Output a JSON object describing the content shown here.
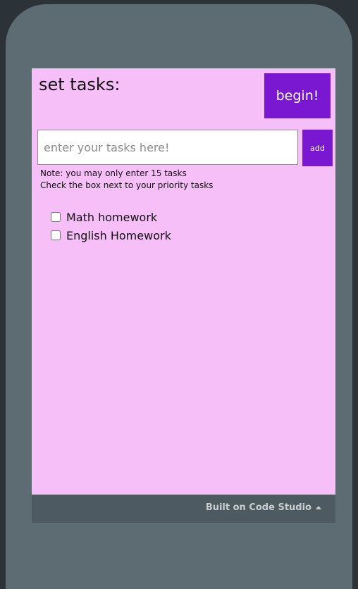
{
  "app": {
    "title": "set tasks:",
    "begin_label": "begin!"
  },
  "input": {
    "placeholder": "enter your tasks here!",
    "value": "",
    "add_label": "add"
  },
  "notes": {
    "line1": "Note: you may only enter 15 tasks",
    "line2": "Check the box next to your priority tasks"
  },
  "tasks": [
    {
      "label": "Math homework",
      "checked": false
    },
    {
      "label": "English Homework",
      "checked": false
    }
  ],
  "footer": {
    "label": "Built on Code Studio",
    "icon": "caret-up-icon"
  },
  "colors": {
    "screen_bg": "#f6bff7",
    "accent": "#7a18d1",
    "frame": "#5d6b72",
    "footer_bg": "#4e5a61"
  }
}
